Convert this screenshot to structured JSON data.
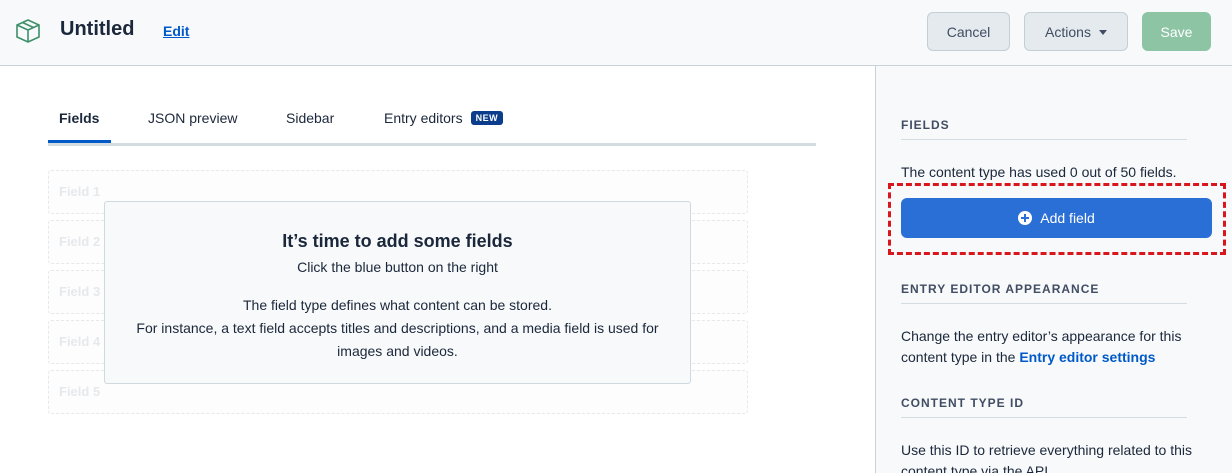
{
  "header": {
    "title": "Untitled",
    "edit_label": "Edit",
    "cancel_label": "Cancel",
    "actions_label": "Actions",
    "save_label": "Save",
    "logo_icon": "content-type-box-icon"
  },
  "tabs": [
    {
      "label": "Fields",
      "active": true
    },
    {
      "label": "JSON preview",
      "active": false
    },
    {
      "label": "Sidebar",
      "active": false
    },
    {
      "label": "Entry editors",
      "active": false,
      "badge": "NEW"
    }
  ],
  "placeholders": [
    "Field 1",
    "Field 2",
    "Field 3",
    "Field 4",
    "Field 5"
  ],
  "empty_state": {
    "title": "It’s time to add some fields",
    "subtitle": "Click the blue button on the right",
    "body_line1": "The field type defines what content can be stored.",
    "body_line2": "For instance, a text field accepts titles and descriptions, and a media field is used for images and videos."
  },
  "sidebar": {
    "fields_heading": "FIELDS",
    "fields_usage": "The content type has used 0 out of 50 fields.",
    "add_field_label": "Add field",
    "appearance_heading": "ENTRY EDITOR APPEARANCE",
    "appearance_text": "Change the entry editor’s appearance for this content type in the ",
    "appearance_link": "Entry editor settings",
    "ctid_heading": "CONTENT TYPE ID",
    "ctid_text": "Use this ID to retrieve everything related to this content type via the API."
  },
  "colors": {
    "primary": "#2a6fd6",
    "save_disabled": "#8dc4a4",
    "highlight": "#d9161c"
  }
}
